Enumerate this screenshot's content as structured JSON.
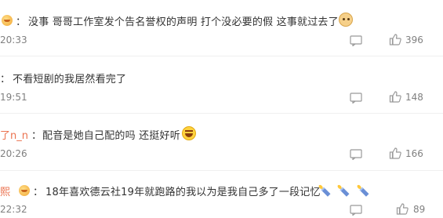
{
  "comments": [
    {
      "nickname": "",
      "colon": "：",
      "text": "没事 哥哥工作室发个告名誉权的声明 打个没必要的假 这事就过去了",
      "emoji": "doge-icon",
      "time": "20:33",
      "likes": "396"
    },
    {
      "nickname": "",
      "colon": "：",
      "text": "不看短剧的我居然看完了",
      "emoji": "",
      "time": "19:51",
      "likes": "148"
    },
    {
      "nickname": "了n_n",
      "colon": "：",
      "text": "配音是她自己配的吗 还挺好听",
      "emoji": "laugh-cry-icon",
      "time": "20:26",
      "likes": "166"
    },
    {
      "nickname": "熙",
      "colon": "：",
      "text": "18年喜欢德云社19年就跑路的我以为是我自己多了一段记忆",
      "emoji": "candle-icon",
      "time": "22:32",
      "likes": "89"
    }
  ],
  "colors": {
    "nickname": "#eb7350",
    "text": "#333333",
    "meta": "#808080"
  }
}
